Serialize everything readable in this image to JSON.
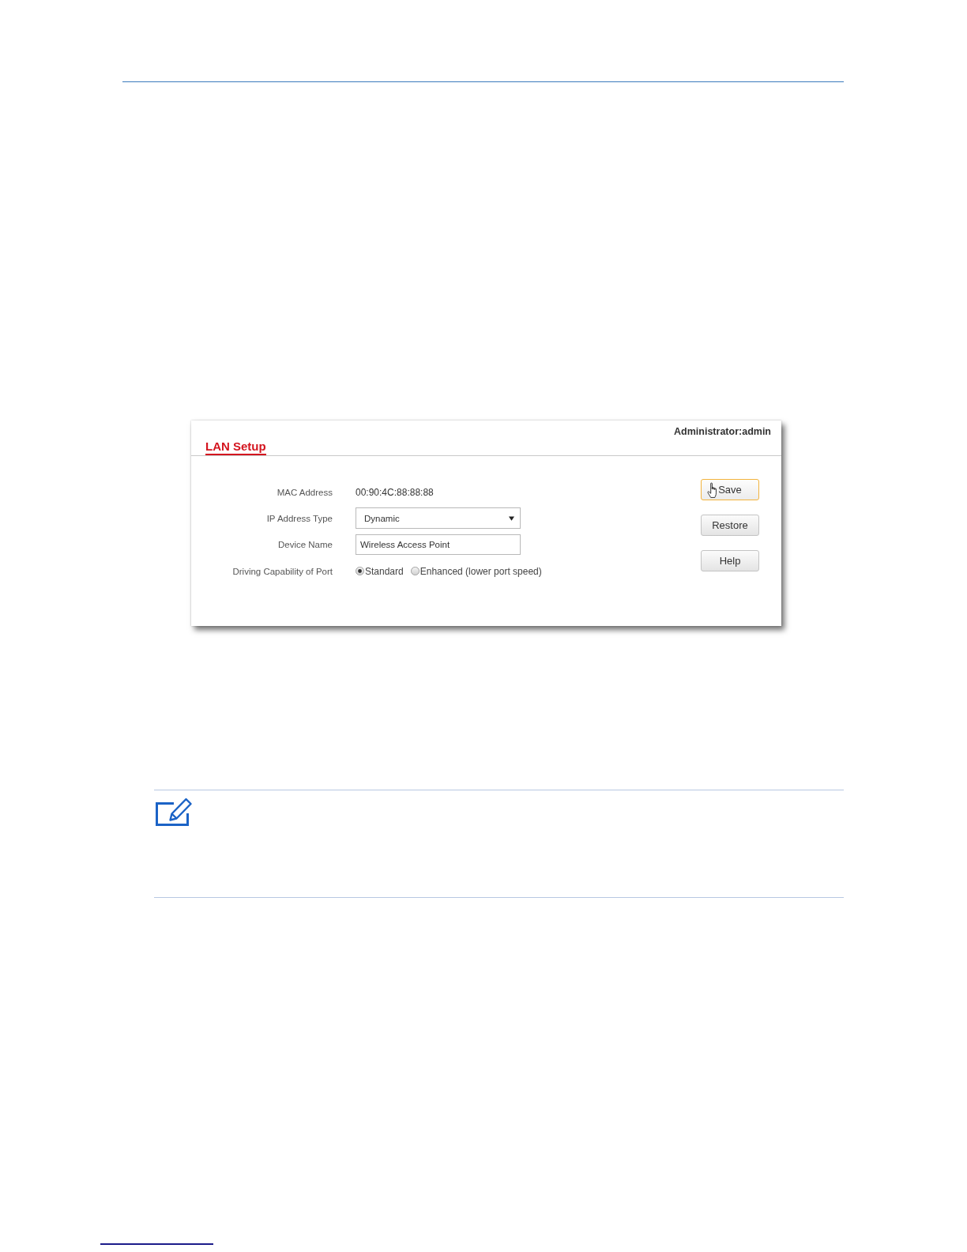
{
  "panel": {
    "user": "Administrator:admin",
    "title": "LAN Setup"
  },
  "fields": [
    {
      "kind": "text",
      "label": "MAC Address",
      "value": "00:90:4C:88:88:88"
    },
    {
      "kind": "select",
      "label": "IP Address Type",
      "value": "Dynamic"
    },
    {
      "kind": "input",
      "label": "Device Name",
      "value": "Wireless Access Point"
    },
    {
      "kind": "radio",
      "label": "Driving Capability of Port",
      "options": [
        {
          "label": "Standard",
          "selected": true
        },
        {
          "label": "Enhanced (lower port speed)",
          "selected": false
        }
      ]
    }
  ],
  "buttons": [
    {
      "label": "Save",
      "hovered": true
    },
    {
      "label": "Restore",
      "hovered": false
    },
    {
      "label": "Help",
      "hovered": false
    }
  ]
}
